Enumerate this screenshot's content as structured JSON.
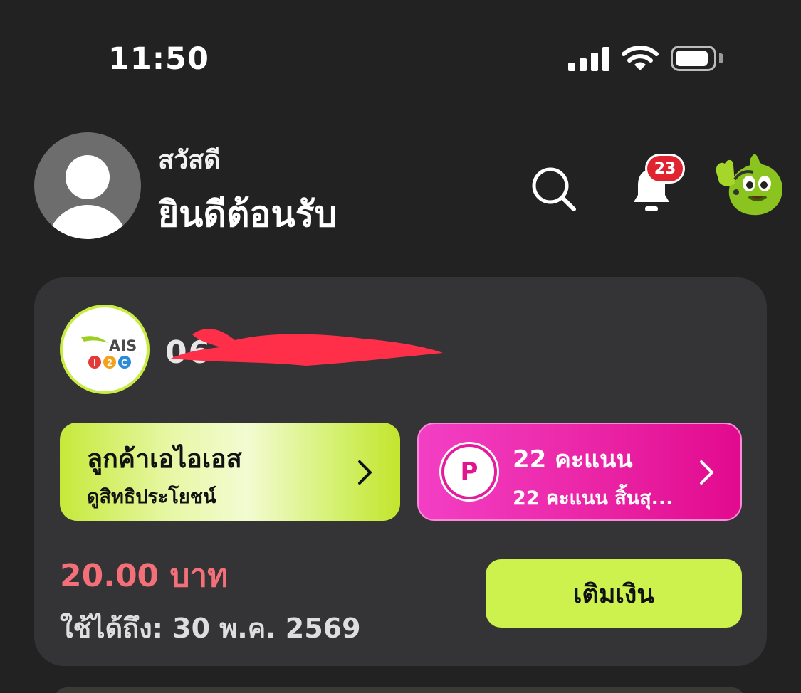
{
  "status_bar": {
    "time": "11:50",
    "signal_icon": "cellular-signal-icon",
    "wifi_icon": "wifi-icon",
    "battery_icon": "battery-icon"
  },
  "header": {
    "greeting_small": "สวัสดี",
    "greeting_big": "ยินดีต้อนรับ",
    "search_icon": "search-icon",
    "bell_icon": "bell-icon",
    "notification_count": "23",
    "mascot_icon": "mascot-icon"
  },
  "account": {
    "brand": "AIS",
    "brand_sub": "I2C",
    "phone_visible": "06",
    "phone_redacted": true
  },
  "ais_pill": {
    "title": "ลูกค้าเอไอเอส",
    "subtitle": "ดูสิทธิประโยชน์"
  },
  "points_pill": {
    "badge": "P",
    "title": "22 คะแนน",
    "subtitle": "22 คะแนน สิ้นสุ..."
  },
  "balance": {
    "amount": "20.00 บาท",
    "validity": "ใช้ได้ถึง: 30 พ.ค. 2569",
    "topup_label": "เติมเงิน"
  },
  "colors": {
    "background": "#222223",
    "card": "#343436",
    "accent_green": "#cdf24d",
    "accent_pink": "#e20a8e",
    "balance_red": "#f37079",
    "badge_red": "#e1232f"
  }
}
